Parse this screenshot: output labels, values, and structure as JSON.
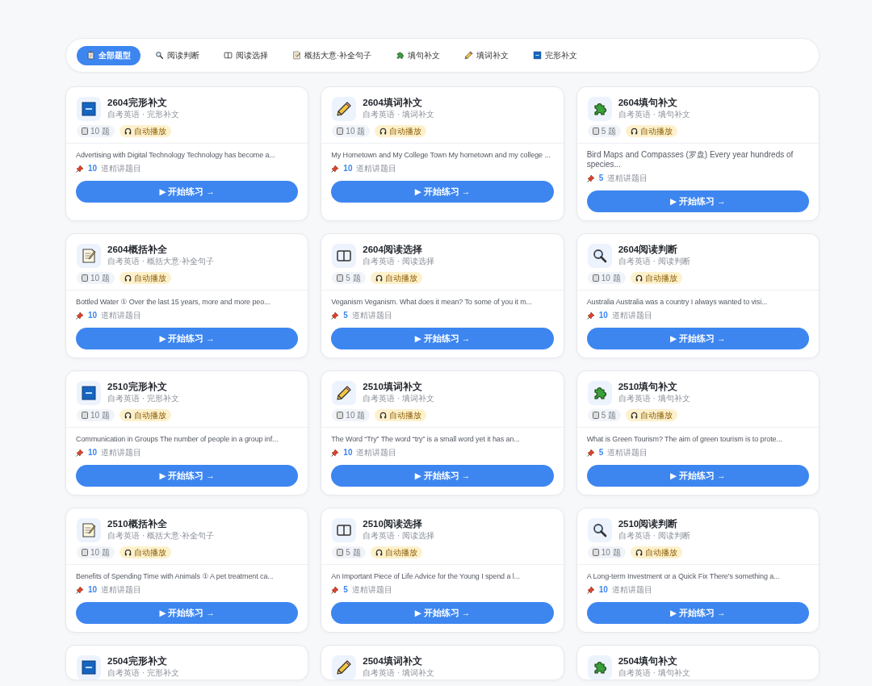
{
  "filters": [
    {
      "label": "全部题型",
      "kind": "clipboard",
      "selected": true
    },
    {
      "label": "阅读判断",
      "kind": "magnifier",
      "selected": false
    },
    {
      "label": "阅读选择",
      "kind": "book",
      "selected": false
    },
    {
      "label": "概括大意·补全句子",
      "kind": "memo",
      "selected": false
    },
    {
      "label": "填句补文",
      "kind": "puzzle",
      "selected": false
    },
    {
      "label": "填词补文",
      "kind": "pencil",
      "selected": false
    },
    {
      "label": "完形补文",
      "kind": "cloze",
      "selected": false
    }
  ],
  "cards": [
    {
      "kind": "cloze",
      "title": "2604完形补文",
      "subtitle": "自考英语 · 完形补文",
      "count": "10 题",
      "audio": "自动播放",
      "excerpt": "Advertising with Digital Technology Technology has become a...",
      "featured_count": "10",
      "featured_label": "道精讲题目",
      "button": "▶ 开始练习 →"
    },
    {
      "kind": "pencil",
      "title": "2604填词补文",
      "subtitle": "自考英语 · 填词补文",
      "count": "10 题",
      "audio": "自动播放",
      "excerpt": "My Hometown and My College Town My hometown and my college ...",
      "featured_count": "10",
      "featured_label": "道精讲题目",
      "button": "▶ 开始练习 →"
    },
    {
      "kind": "puzzle",
      "title": "2604填句补文",
      "subtitle": "自考英语 · 填句补文",
      "count": "5 题",
      "audio": "自动播放",
      "excerpt": "Bird Maps and Compasses (罗盘) Every year hundreds of species...",
      "featured_count": "5",
      "featured_label": "道精讲题目",
      "button": "▶ 开始练习 →"
    },
    {
      "kind": "memo",
      "title": "2604概括补全",
      "subtitle": "自考英语 · 概括大意·补全句子",
      "count": "10 题",
      "audio": "自动播放",
      "excerpt": "Bottled Water ① Over the last 15 years, more and more peo...",
      "featured_count": "10",
      "featured_label": "道精讲题目",
      "button": "▶ 开始练习 →"
    },
    {
      "kind": "book",
      "title": "2604阅读选择",
      "subtitle": "自考英语 · 阅读选择",
      "count": "5 题",
      "audio": "自动播放",
      "excerpt": "Veganism Veganism. What does it mean? To some of you it m...",
      "featured_count": "5",
      "featured_label": "道精讲题目",
      "button": "▶ 开始练习 →"
    },
    {
      "kind": "magnifier",
      "title": "2604阅读判断",
      "subtitle": "自考英语 · 阅读判断",
      "count": "10 题",
      "audio": "自动播放",
      "excerpt": "Australia Australia was a country I always wanted to visi...",
      "featured_count": "10",
      "featured_label": "道精讲题目",
      "button": "▶ 开始练习 →"
    },
    {
      "kind": "cloze",
      "title": "2510完形补文",
      "subtitle": "自考英语 · 完形补文",
      "count": "10 题",
      "audio": "自动播放",
      "excerpt": "Communication in Groups The number of people in a group inf...",
      "featured_count": "10",
      "featured_label": "道精讲题目",
      "button": "▶ 开始练习 →"
    },
    {
      "kind": "pencil",
      "title": "2510填词补文",
      "subtitle": "自考英语 · 填词补文",
      "count": "10 题",
      "audio": "自动播放",
      "excerpt": "The Word “Try” The word “try” is a small word yet it has an...",
      "featured_count": "10",
      "featured_label": "道精讲题目",
      "button": "▶ 开始练习 →"
    },
    {
      "kind": "puzzle",
      "title": "2510填句补文",
      "subtitle": "自考英语 · 填句补文",
      "count": "5 题",
      "audio": "自动播放",
      "excerpt": "What is Green Tourism? The aim of green tourism is to prote...",
      "featured_count": "5",
      "featured_label": "道精讲题目",
      "button": "▶ 开始练习 →"
    },
    {
      "kind": "memo",
      "title": "2510概括补全",
      "subtitle": "自考英语 · 概括大意·补全句子",
      "count": "10 题",
      "audio": "自动播放",
      "excerpt": "Benefits of Spending Time with Animals ① A pet treatment ca...",
      "featured_count": "10",
      "featured_label": "道精讲题目",
      "button": "▶ 开始练习 →"
    },
    {
      "kind": "book",
      "title": "2510阅读选择",
      "subtitle": "自考英语 · 阅读选择",
      "count": "5 题",
      "audio": "自动播放",
      "excerpt": "An Important Piece of Life Advice for the Young I spend a l...",
      "featured_count": "5",
      "featured_label": "道精讲题目",
      "button": "▶ 开始练习 →"
    },
    {
      "kind": "magnifier",
      "title": "2510阅读判断",
      "subtitle": "自考英语 · 阅读判断",
      "count": "10 题",
      "audio": "自动播放",
      "excerpt": "A Long-term Investment or a Quick Fix There's something a...",
      "featured_count": "10",
      "featured_label": "道精讲题目",
      "button": "▶ 开始练习 →"
    },
    {
      "kind": "cloze",
      "title": "2504完形补文",
      "subtitle": "自考英语 · 完形补文"
    },
    {
      "kind": "pencil",
      "title": "2504填词补文",
      "subtitle": "自考英语 · 填词补文"
    },
    {
      "kind": "puzzle",
      "title": "2504填句补文",
      "subtitle": "自考英语 · 填句补文"
    }
  ]
}
